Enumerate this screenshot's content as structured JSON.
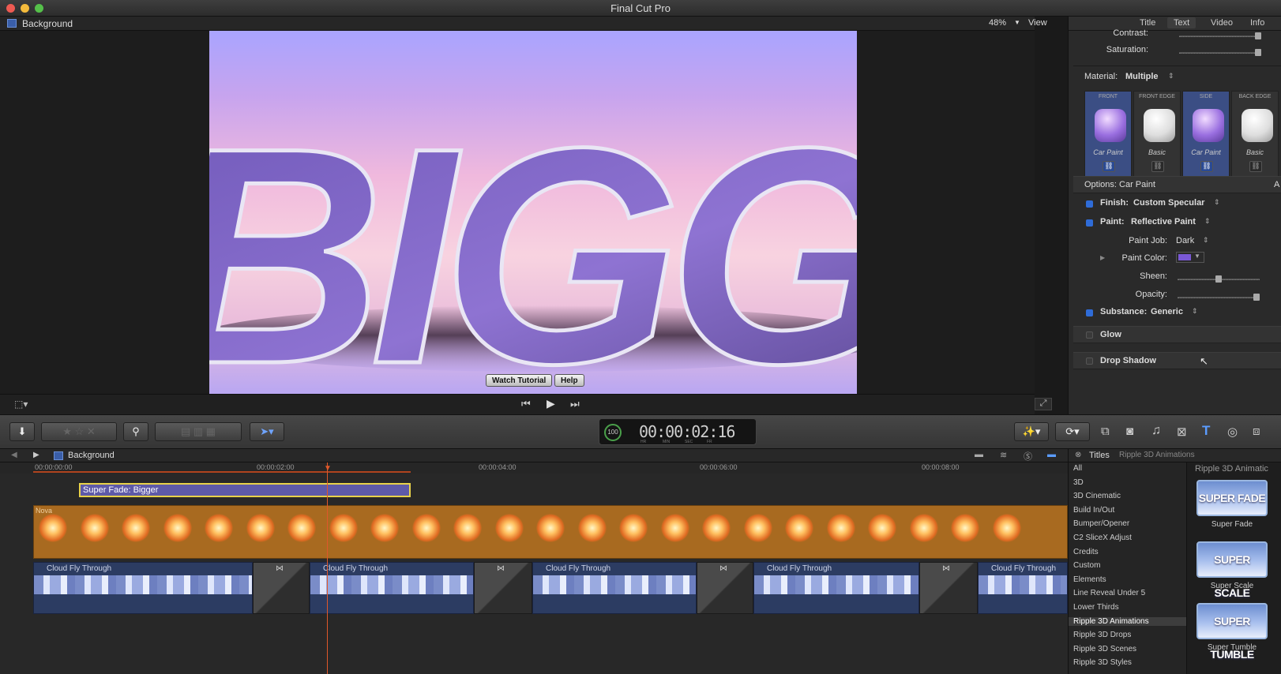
{
  "app": {
    "title": "Final Cut Pro"
  },
  "viewer": {
    "project_name": "Background",
    "zoom": "48%",
    "view_label": "View",
    "canvas_text": "BIGGE",
    "watch_tutorial": "Watch Tutorial",
    "help": "Help"
  },
  "inspector": {
    "tabs": [
      "Title",
      "Text",
      "Video",
      "Info"
    ],
    "contrast_label": "Contrast:",
    "saturation_label": "Saturation:",
    "material_label": "Material:",
    "material_value": "Multiple",
    "materials": [
      {
        "caption": "FRONT",
        "name": "Car Paint",
        "selected": true
      },
      {
        "caption": "FRONT EDGE",
        "name": "Basic",
        "selected": false
      },
      {
        "caption": "SIDE",
        "name": "Car Paint",
        "selected": true
      },
      {
        "caption": "BACK EDGE",
        "name": "Basic",
        "selected": false
      }
    ],
    "options_label": "Options: Car Paint",
    "options_suffix": "A",
    "finish_label": "Finish:",
    "finish_value": "Custom Specular",
    "paint_label": "Paint:",
    "paint_value": "Reflective Paint",
    "paint_job_label": "Paint Job:",
    "paint_job_value": "Dark",
    "paint_color_label": "Paint Color:",
    "paint_color": "#7a58d6",
    "sheen_label": "Sheen:",
    "sheen_level": 0.5,
    "opacity_label": "Opacity:",
    "opacity_level": 1.0,
    "contrast_level": 1.0,
    "saturation_level": 1.0,
    "substance_label": "Substance:",
    "substance_value": "Generic",
    "glow_label": "Glow",
    "drop_shadow_label": "Drop Shadow"
  },
  "toolbar": {
    "timecode": "00:00:02:16",
    "timecode_units": [
      "HR",
      "MIN",
      "SEC",
      "FR"
    ],
    "percent": "100"
  },
  "timeline": {
    "project_name": "Background",
    "ruler": [
      "00:00:00:00",
      "00:00:02:00",
      "00:00:04:00",
      "00:00:06:00",
      "00:00:08:00"
    ],
    "title_clip": "Super Fade: Bigger",
    "nova_clip": "Nova",
    "cloud_clips": [
      "Cloud Fly Through",
      "Cloud Fly Through",
      "Cloud Fly Through",
      "Cloud Fly Through",
      "Cloud Fly Through"
    ]
  },
  "browser": {
    "header": "Titles",
    "breadcrumb": "Ripple 3D Animations",
    "thumbs_header": "Ripple 3D Animatic",
    "categories": [
      "All",
      "3D",
      "3D Cinematic",
      "Build In/Out",
      "Bumper/Opener",
      "C2 SliceX Adjust",
      "Credits",
      "Custom",
      "Elements",
      "Line Reveal Under 5",
      "Lower Thirds",
      "Ripple 3D Animations",
      "Ripple 3D Drops",
      "Ripple 3D Scenes",
      "Ripple 3D Styles"
    ],
    "selected_category": "Ripple 3D Animations",
    "thumbnails": [
      {
        "art": "SUPER FADE",
        "label": "Super Fade"
      },
      {
        "art": "SUPER SCALE",
        "label": "Super Scale"
      },
      {
        "art": "SUPER TUMBLE",
        "label": "Super Tumble"
      }
    ]
  }
}
